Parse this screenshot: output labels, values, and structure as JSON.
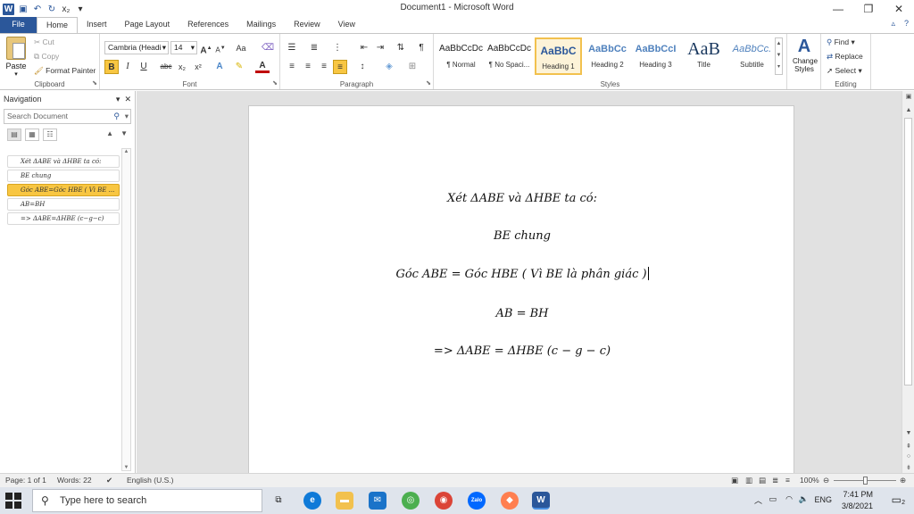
{
  "window": {
    "title": "Document1  -  Microsoft Word",
    "app_icon": "W"
  },
  "tabs": [
    "File",
    "Home",
    "Insert",
    "Page Layout",
    "References",
    "Mailings",
    "Review",
    "View"
  ],
  "clipboard": {
    "paste": "Paste",
    "cut": "Cut",
    "copy": "Copy",
    "format_painter": "Format Painter",
    "label": "Clipboard"
  },
  "font": {
    "name": "Cambria (Headi",
    "size": "14",
    "label": "Font",
    "bold": "B",
    "italic": "I",
    "underline": "U",
    "strike": "abc",
    "subscript": "x₂",
    "superscript": "x²",
    "grow": "A",
    "shrink": "A",
    "case": "Aa"
  },
  "paragraph": {
    "label": "Paragraph"
  },
  "styles": {
    "label": "Styles",
    "items": [
      {
        "sample": "AaBbCcDc",
        "name": "¶ Normal"
      },
      {
        "sample": "AaBbCcDc",
        "name": "¶ No Spaci..."
      },
      {
        "sample": "AaBbC",
        "name": "Heading 1"
      },
      {
        "sample": "AaBbCc",
        "name": "Heading 2"
      },
      {
        "sample": "AaBbCcI",
        "name": "Heading 3"
      },
      {
        "sample": "AaB",
        "name": "Title"
      },
      {
        "sample": "AaBbCc.",
        "name": "Subtitle"
      }
    ],
    "change_styles": "Change Styles"
  },
  "editing": {
    "label": "Editing",
    "find": "Find",
    "replace": "Replace",
    "select": "Select"
  },
  "navigation": {
    "title": "Navigation",
    "search_placeholder": "Search Document",
    "headings": [
      "Xét ΔABE và ΔHBE ta có:",
      "BE chung",
      "Góc ABE=Góc HBE ( Vì BE ...",
      "AB=BH",
      "=> ΔABE=ΔHBE (c−g−c)"
    ]
  },
  "document": {
    "lines": [
      "Xét ΔABE và ΔHBE ta có:",
      "BE chung",
      "Góc ABE = Góc HBE ( Vì BE là phân giác )",
      "AB = BH",
      "=>  ΔABE = ΔHBE (c − g − c)"
    ]
  },
  "status": {
    "page": "Page: 1 of 1",
    "words": "Words: 22",
    "language": "English (U.S.)",
    "zoom": "100%"
  },
  "taskbar": {
    "search_placeholder": "Type here to search",
    "time": "7:41 PM",
    "date": "3/8/2021",
    "lang": "ENG",
    "notifications": "2"
  }
}
